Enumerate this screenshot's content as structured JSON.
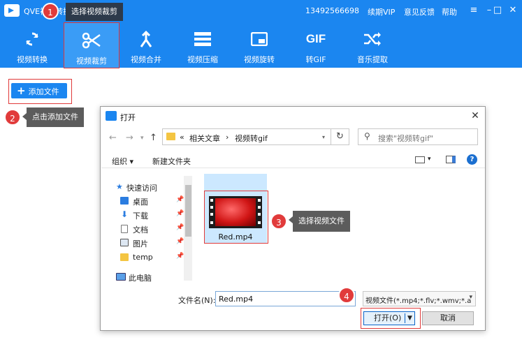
{
  "app": {
    "title": "QVE视频转换",
    "phone": "13492566698",
    "vip": "续期VIP",
    "feedback": "意见反馈",
    "help": "帮助"
  },
  "window_controls": {
    "menu": "≡",
    "minimize": "–",
    "maximize": "□",
    "close": "✕"
  },
  "toolbar": {
    "items": [
      {
        "label": "视频转换",
        "icon": "refresh-icon"
      },
      {
        "label": "视频裁剪",
        "icon": "scissors-icon"
      },
      {
        "label": "视频合并",
        "icon": "merge-icon"
      },
      {
        "label": "视频压缩",
        "icon": "compress-icon"
      },
      {
        "label": "视频旋转",
        "icon": "rotate-icon"
      },
      {
        "label": "转GIF",
        "icon": "gif-icon"
      },
      {
        "label": "音乐提取",
        "icon": "shuffle-icon"
      }
    ],
    "gif_glyph": "GIF"
  },
  "add_file": {
    "label": "添加文件"
  },
  "callouts": [
    {
      "num": "1",
      "text": "选择视频裁剪"
    },
    {
      "num": "2",
      "text": "点击添加文件"
    },
    {
      "num": "3",
      "text": "选择视频文件"
    },
    {
      "num": "4",
      "text": ""
    }
  ],
  "dialog": {
    "title": "打开",
    "breadcrumb": {
      "prefix": "«",
      "part1": "相关文章",
      "sep": "›",
      "part2": "视频转gif"
    },
    "search_placeholder": "搜索\"视频转gif\"",
    "organize": "组织 ▾",
    "new_folder": "新建文件夹",
    "nav": [
      {
        "label": "快速访问",
        "icon": "star-icon"
      },
      {
        "label": "桌面",
        "icon": "desktop-icon"
      },
      {
        "label": "下载",
        "icon": "download-icon"
      },
      {
        "label": "文档",
        "icon": "document-icon"
      },
      {
        "label": "图片",
        "icon": "picture-icon"
      },
      {
        "label": "temp",
        "icon": "folder-icon"
      },
      {
        "label": "此电脑",
        "icon": "computer-icon"
      }
    ],
    "file": {
      "name": "Red.mp4"
    },
    "filename_label": "文件名(N):",
    "filename_value": "Red.mp4",
    "filetype": "视频文件(*.mp4;*.flv;*.wmv;*.a",
    "open_label": "打开(O)",
    "cancel_label": "取消"
  },
  "colors": {
    "primary": "#1b86f0",
    "callout_red": "#e13b3b",
    "outline_red": "#e03a3a"
  }
}
